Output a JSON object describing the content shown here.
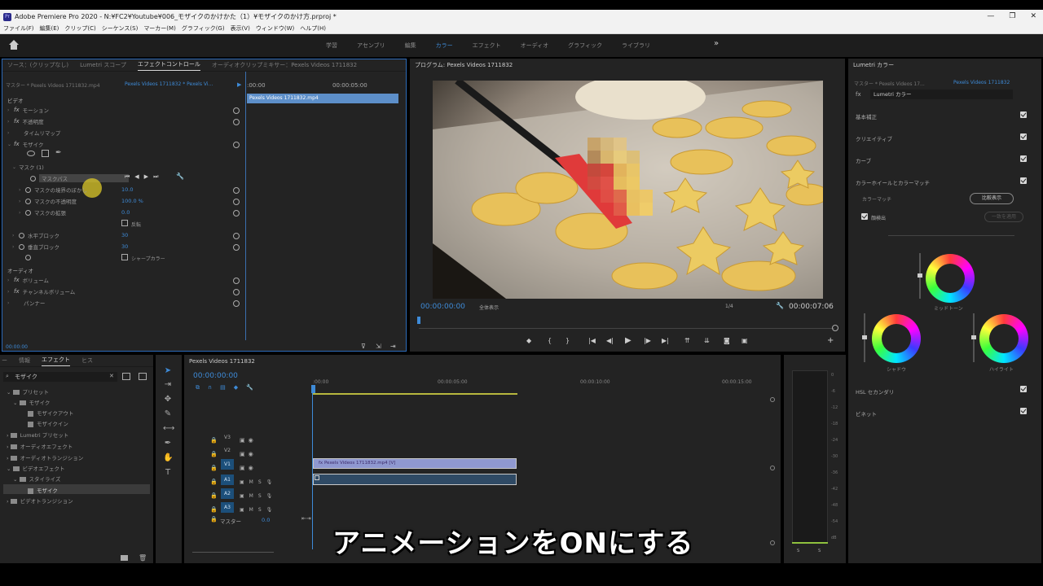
{
  "window": {
    "title": "Adobe Premiere Pro 2020 - N:¥FC2¥Youtube¥006_モザイクのかけかた（1）¥モザイクのかけ方.prproj *",
    "app_icon_label": "Pr",
    "buttons": [
      "—",
      "❐",
      "✕"
    ]
  },
  "menu": [
    "ファイル(F)",
    "編集(E)",
    "クリップ(C)",
    "シーケンス(S)",
    "マーカー(M)",
    "グラフィック(G)",
    "表示(V)",
    "ウィンドウ(W)",
    "ヘルプ(H)"
  ],
  "workspaces": {
    "tabs": [
      "学習",
      "アセンブリ",
      "編集",
      "カラー",
      "エフェクト",
      "オーディオ",
      "グラフィック",
      "ライブラリ"
    ],
    "active": "カラー",
    "more": "»"
  },
  "effect_controls": {
    "tabs": [
      "ソース：(クリップなし)",
      "Lumetri スコープ",
      "エフェクトコントロール",
      "オーディオクリップミキサー：Pexels Videos 1711832"
    ],
    "active_tab": "エフェクトコントロール",
    "master_label": "マスター * Pexels Videos 1711832.mp4",
    "clip_label": "Pexels Videos 1711832 * Pexels Vi...",
    "mini_timeline": {
      "start": ":00:00",
      "end": "00:00:05:00",
      "clip_name": "Pexels Videos 1711832.mp4"
    },
    "video_section": "ビデオ",
    "audio_section": "オーディオ",
    "rows": [
      {
        "label": "モーション",
        "fx": true
      },
      {
        "label": "不透明度",
        "fx": true
      },
      {
        "label": "タイムリマップ",
        "fx": false
      },
      {
        "label": "モザイク",
        "fx": true
      },
      {
        "label": "マスク (1)",
        "fx": false
      },
      {
        "label": "マスクパス",
        "fx": false
      },
      {
        "label": "マスクの境界のぼかし",
        "value": "10.0"
      },
      {
        "label": "マスクの不透明度",
        "value": "100.0 %"
      },
      {
        "label": "マスクの拡張",
        "value": "0.0"
      },
      {
        "label": "反転",
        "checkbox": true
      },
      {
        "label": "水平ブロック",
        "value": "30"
      },
      {
        "label": "垂直ブロック",
        "value": "30"
      },
      {
        "label": "シャープカラー",
        "checkbox": true
      },
      {
        "label": "ボリューム",
        "fx": true
      },
      {
        "label": "チャンネルボリューム",
        "fx": true
      },
      {
        "label": "パンナー",
        "fx": false
      }
    ],
    "timecode": "00:00:00"
  },
  "program": {
    "title": "プログラム: Pexels Videos 1711832",
    "timecode_current": "00:00:00:00",
    "fit_label": "全体表示",
    "quality": "1/4",
    "timecode_duration": "00:00:07:06"
  },
  "lumetri": {
    "title": "Lumetri カラー",
    "master_label": "マスター * Pexels Videos 17...",
    "clip_label": "Pexels Videos 1711832",
    "preset_label": "Lumetri カラー",
    "sections": [
      "基本補正",
      "クリエイティブ",
      "カーブ",
      "カラーホイールとカラーマッチ",
      "HSL セカンダリ",
      "ビネット"
    ],
    "color_match": "カラーマッチ",
    "compare_button": "比較表示",
    "face_detect": "顔検出",
    "apply_match": "一致を適用",
    "wheels": [
      "ミッドトーン",
      "シャドウ",
      "ハイライト"
    ]
  },
  "project": {
    "tabs": [
      "ー",
      "情報",
      "エフェクト",
      "ヒス"
    ],
    "active_tab": "エフェクト",
    "search_value": "モザイク",
    "tree": [
      {
        "label": "プリセット",
        "indent": 0
      },
      {
        "label": "モザイク",
        "indent": 1
      },
      {
        "label": "モザイクアウト",
        "indent": 2
      },
      {
        "label": "モザイクイン",
        "indent": 2
      },
      {
        "label": "Lumetri プリセット",
        "indent": 0
      },
      {
        "label": "オーディオエフェクト",
        "indent": 0
      },
      {
        "label": "オーディオトランジション",
        "indent": 0
      },
      {
        "label": "ビデオエフェクト",
        "indent": 0
      },
      {
        "label": "スタイライズ",
        "indent": 1
      },
      {
        "label": "モザイク",
        "indent": 2
      },
      {
        "label": "ビデオトランジション",
        "indent": 0
      }
    ]
  },
  "timeline": {
    "title": "Pexels Videos 1711832",
    "timecode": "00:00:00:00",
    "ruler": [
      ":00:00",
      "00:00:05:00",
      "00:00:10:00",
      "00:00:15:00"
    ],
    "tracks": [
      {
        "name": "V3",
        "on": false
      },
      {
        "name": "V2",
        "on": false
      },
      {
        "name": "V1",
        "on": true
      },
      {
        "name": "A1",
        "on": true
      },
      {
        "name": "A2",
        "on": true
      },
      {
        "name": "A3",
        "on": true
      }
    ],
    "master_label": "マスター",
    "master_value": "0.0",
    "video_clip": "fx Pexels Videos 1711832.mp4 [V]",
    "meter_ticks": [
      "0",
      "-6",
      "-12",
      "-18",
      "-24",
      "-30",
      "-36",
      "-42",
      "-48",
      "-54",
      "dB"
    ],
    "meter_bottom": [
      "S",
      "S"
    ]
  },
  "caption": "アニメーションをONにする"
}
